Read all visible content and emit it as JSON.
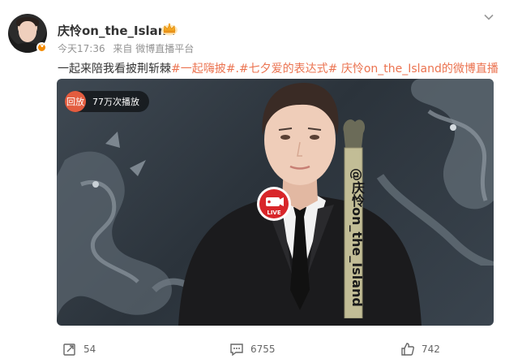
{
  "post": {
    "username": "庆怜on_the_Island",
    "time": "今天17:36",
    "source": "来自 微博直播平台",
    "text": {
      "plain": "一起来陪我看披荆斩棘",
      "tags": "#一起嗨披#.#七夕爱的表达式#",
      "tail": " 庆怜on_the_Island的微博直播"
    }
  },
  "video": {
    "replay_label": "回放",
    "play_count": "77万次播放",
    "live_label": "LIVE",
    "banner_text": "@庆怜on_the_Island"
  },
  "actions": {
    "repost_count": "54",
    "comment_count": "6755",
    "like_count": "742"
  },
  "colors": {
    "accent": "#eb7350",
    "replay": "#e35c3f",
    "live_red": "#d8262a"
  }
}
